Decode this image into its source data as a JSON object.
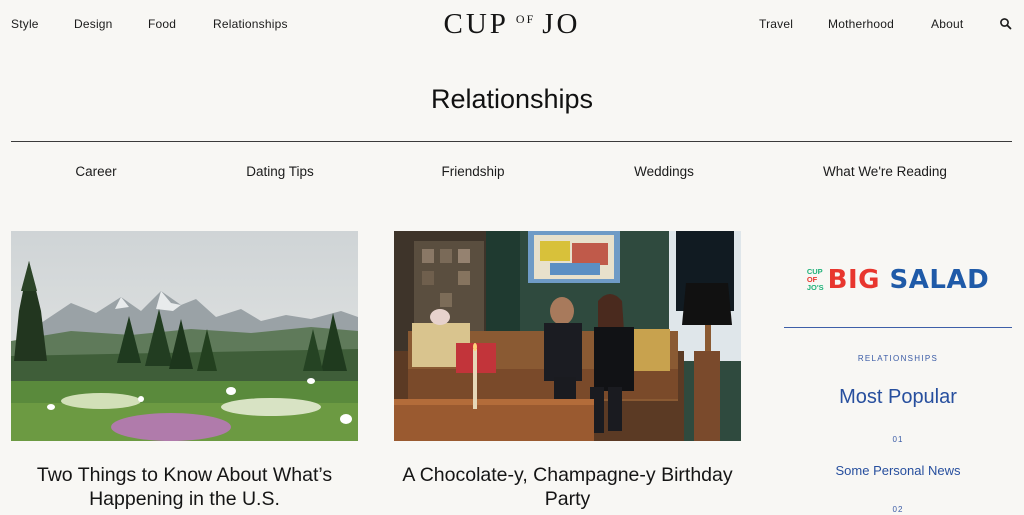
{
  "header": {
    "nav_left": [
      "Style",
      "Design",
      "Food",
      "Relationships"
    ],
    "nav_right": [
      "Travel",
      "Motherhood",
      "About"
    ],
    "logo": {
      "part1": "CUP",
      "part2": "OF",
      "part3": "JO"
    },
    "search_icon": "search-icon"
  },
  "page": {
    "title": "Relationships"
  },
  "subnav": [
    "Career",
    "Dating Tips",
    "Friendship",
    "Weddings",
    "What We're Reading"
  ],
  "articles": [
    {
      "title": "Two Things to Know About What’s Happening in the U.S.",
      "image": "mountain-meadow-photo"
    },
    {
      "title": "A Chocolate-y, Champagne-y Birthday Party",
      "image": "couple-on-sofa-photo"
    }
  ],
  "sidebar": {
    "promo": {
      "small_lines": [
        "CUP",
        "OF",
        "JO'S"
      ],
      "big": "BIG",
      "salad": "SALAD"
    },
    "label": "RELATIONSHIPS",
    "heading": "Most Popular",
    "popular": [
      {
        "number": "01",
        "title": "Some Personal News"
      },
      {
        "number": "02",
        "title": ""
      }
    ]
  },
  "colors": {
    "background": "#f8f7f4",
    "text": "#1b1b1b",
    "sidebar_blue": "#274f9e",
    "promo_red": "#e8362e",
    "promo_green": "#20b27a"
  }
}
